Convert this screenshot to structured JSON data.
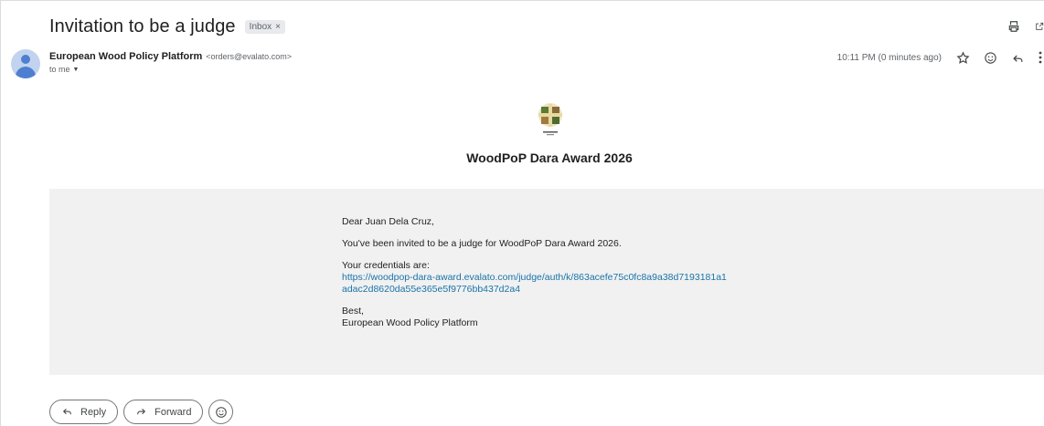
{
  "email": {
    "subject": "Invitation to be a judge",
    "label": "Inbox",
    "label_remove": "×",
    "sender_name": "European Wood Policy Platform",
    "sender_email": "<orders@evalato.com>",
    "to": "to me",
    "timestamp": "10:11 PM (0 minutes ago)"
  },
  "body": {
    "heading": "WoodPoP Dara Award 2026",
    "greeting": "Dear Juan Dela Cruz,",
    "invite_line": "You've been invited to be a judge for WoodPoP Dara Award 2026.",
    "credentials_label": "Your credentials are:",
    "link_line1": "https://woodpop-dara-award.evalato.com/judge/auth/k/863acefe75c0fc8a9a38d7193181a1",
    "link_line2": "adac2d8620da55e365e5f9776bb437d2a4",
    "signoff": "Best,",
    "signature": "European Wood Policy Platform"
  },
  "actions": {
    "reply": "Reply",
    "forward": "Forward"
  },
  "icons": {
    "print": "print-icon",
    "open_new": "open-in-new-window-icon",
    "star": "star-icon",
    "emoji": "emoji-reaction-icon",
    "reply": "reply-icon",
    "more": "more-vert-icon"
  }
}
